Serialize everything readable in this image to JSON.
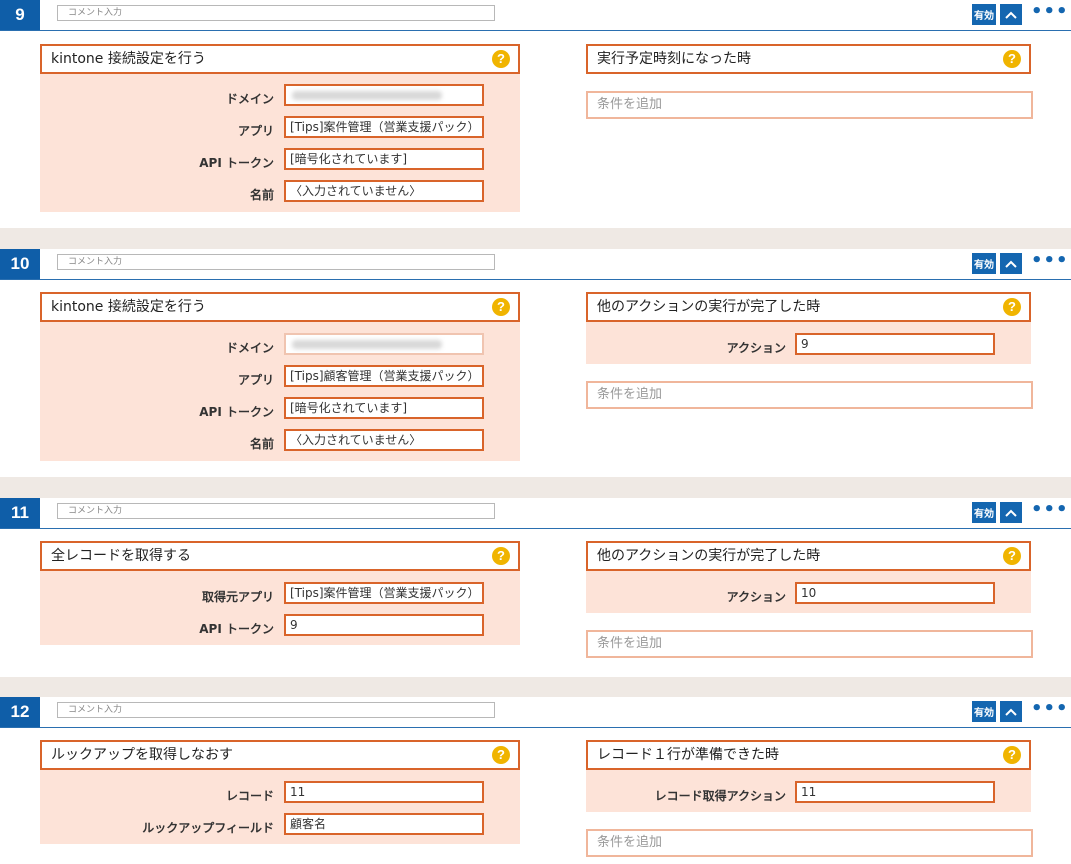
{
  "colors": {
    "accent": "#0f5ea8",
    "border": "#d9642a",
    "panel": "#fde3d8",
    "help": "#f0b400"
  },
  "icons": {
    "help": "question-icon",
    "up": "chevron-up-icon",
    "more": "more-dots-icon"
  },
  "steps": [
    {
      "number": "9",
      "comment_placeholder": "コメント入力",
      "valid_label": "有効",
      "help_glyph": "?",
      "more_glyph": "•••",
      "action": {
        "title": "kintone 接続設定を行う",
        "fields": [
          {
            "label": "ドメイン",
            "value": "",
            "blurred": true
          },
          {
            "label": "アプリ",
            "value": "[Tips]案件管理（営業支援パック）"
          },
          {
            "label": "API トークン",
            "value": "[暗号化されています]"
          },
          {
            "label": "名前",
            "value": "〈入力されていません〉"
          }
        ]
      },
      "condition": {
        "title": "実行予定時刻になった時",
        "fields": []
      },
      "add_condition": "条件を追加"
    },
    {
      "number": "10",
      "comment_placeholder": "コメント入力",
      "valid_label": "有効",
      "help_glyph": "?",
      "more_glyph": "•••",
      "action": {
        "title": "kintone 接続設定を行う",
        "fields": [
          {
            "label": "ドメイン",
            "value": "",
            "blurred": true
          },
          {
            "label": "アプリ",
            "value": "[Tips]顧客管理（営業支援パック）"
          },
          {
            "label": "API トークン",
            "value": "[暗号化されています]"
          },
          {
            "label": "名前",
            "value": "〈入力されていません〉"
          }
        ]
      },
      "condition": {
        "title": "他のアクションの実行が完了した時",
        "fields": [
          {
            "label": "アクション",
            "value": "9"
          }
        ]
      },
      "add_condition": "条件を追加"
    },
    {
      "number": "11",
      "comment_placeholder": "コメント入力",
      "valid_label": "有効",
      "help_glyph": "?",
      "more_glyph": "•••",
      "action": {
        "title": "全レコードを取得する",
        "fields": [
          {
            "label": "取得元アプリ",
            "value": "[Tips]案件管理（営業支援パック）"
          },
          {
            "label": "API トークン",
            "value": "9"
          }
        ]
      },
      "condition": {
        "title": "他のアクションの実行が完了した時",
        "fields": [
          {
            "label": "アクション",
            "value": "10"
          }
        ]
      },
      "add_condition": "条件を追加"
    },
    {
      "number": "12",
      "comment_placeholder": "コメント入力",
      "valid_label": "有効",
      "help_glyph": "?",
      "more_glyph": "•••",
      "action": {
        "title": "ルックアップを取得しなおす",
        "fields": [
          {
            "label": "レコード",
            "value": "11"
          },
          {
            "label": "ルックアップフィールド",
            "value": "顧客名"
          }
        ]
      },
      "condition": {
        "title": "レコード１行が準備できた時",
        "fields": [
          {
            "label": "レコード取得アクション",
            "value": "11"
          }
        ]
      },
      "add_condition": "条件を追加"
    }
  ]
}
